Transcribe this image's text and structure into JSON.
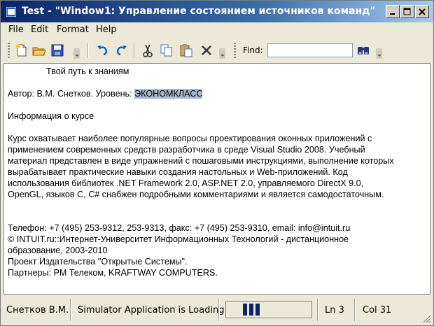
{
  "window": {
    "title": "Test - \"Window1: Управление состоянием источников команд\""
  },
  "menu": [
    "File",
    "Edit",
    "Format",
    "Help"
  ],
  "toolbar": {
    "find_label": "Find:",
    "find_value": ""
  },
  "editor": {
    "line1": "Твой путь к знаниям",
    "author_prefix": "Автор: В.М. Снетков. Уровень: ",
    "level_selected": "ЭКОНОМКЛАСС",
    "course_heading": "Информация о курсе",
    "paragraph": [
      "Курс охватывает наиболее популярные вопросы проектирования оконных приложений с",
      "применением современных средств разработчика в среде Visual Studio 2008. Учебный",
      "материал представлен в виде упражнений с пошаговыми инструкциями, выполнение которых",
      "вырабатывает практические навыки создания настольных и Web-приложений. Код",
      "использования библиотек .NET Framework 2.0, ASP.NET 2.0, управляемого DirectX 9.0,",
      "OpenGL, языков C, C# снабжен подробными комментариями и является самодостаточным."
    ],
    "footer": [
      "Телефон: +7 (495) 253-9312, 253-9313, факс: +7 (495) 253-9310, email: info@intuit.ru",
      "© INTUIT.ru::Интернет-Университет Информационных Технологий - дистанционное",
      "образование, 2003-2010",
      "Проект Издательства \"Открытые Системы\".",
      "Партнеры: РМ Телеком, KRAFTWAY COMPUTERS."
    ]
  },
  "status": {
    "user": "Снетков В.М.",
    "loading": "Simulator Application is Loading",
    "progress_blocks": 3,
    "line": "Ln 3",
    "col": "Col 31"
  },
  "colors": {
    "title_gradient_start": "#0a246a",
    "title_gradient_end": "#a6caf0",
    "selection": "#aab8cf",
    "progress_block": "#0a246a"
  }
}
